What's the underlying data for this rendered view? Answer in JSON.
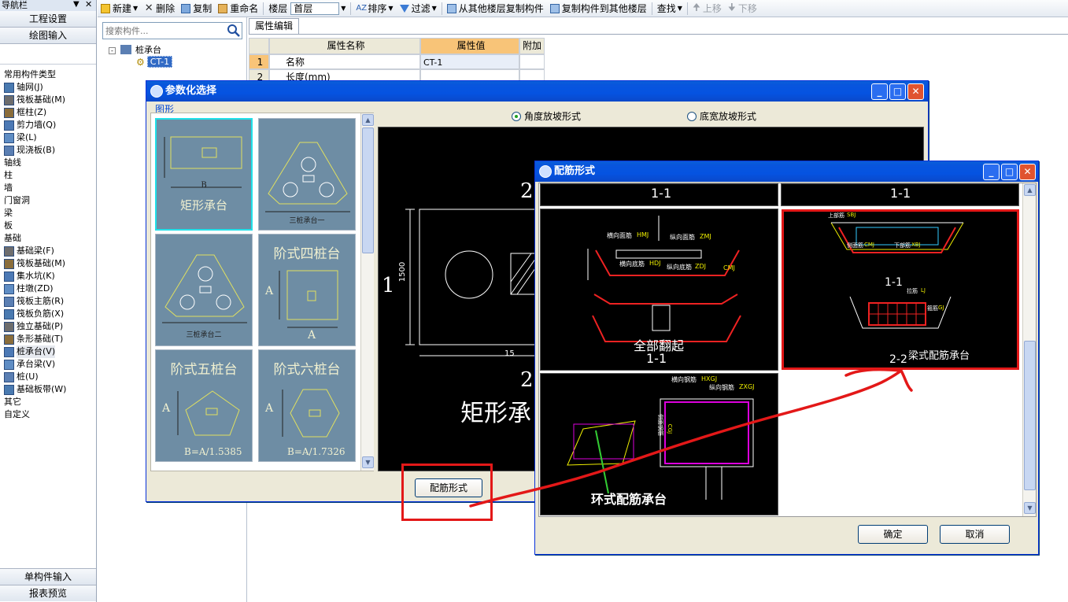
{
  "nav": {
    "title": "导航栏",
    "top_buttons": [
      "工程设置",
      "绘图输入"
    ],
    "tree": [
      {
        "label": "常用构件类型",
        "indent": 0,
        "icon": false
      },
      {
        "label": "轴网(J)",
        "indent": 1,
        "icon": true
      },
      {
        "label": "筏板基础(M)",
        "indent": 1,
        "icon": true
      },
      {
        "label": "框柱(Z)",
        "indent": 1,
        "icon": true
      },
      {
        "label": "剪力墙(Q)",
        "indent": 1,
        "icon": true
      },
      {
        "label": "梁(L)",
        "indent": 1,
        "icon": true
      },
      {
        "label": "现浇板(B)",
        "indent": 1,
        "icon": true
      },
      {
        "label": "轴线",
        "indent": 0,
        "icon": false
      },
      {
        "label": "柱",
        "indent": 0,
        "icon": false
      },
      {
        "label": "墙",
        "indent": 0,
        "icon": false
      },
      {
        "label": "门窗洞",
        "indent": 0,
        "icon": false
      },
      {
        "label": "梁",
        "indent": 0,
        "icon": false
      },
      {
        "label": "板",
        "indent": 0,
        "icon": false
      },
      {
        "label": "基础",
        "indent": 0,
        "icon": false
      },
      {
        "label": "基础梁(F)",
        "indent": 1,
        "icon": true
      },
      {
        "label": "筏板基础(M)",
        "indent": 1,
        "icon": true
      },
      {
        "label": "集水坑(K)",
        "indent": 1,
        "icon": true
      },
      {
        "label": "柱墩(ZD)",
        "indent": 1,
        "icon": true
      },
      {
        "label": "筏板主筋(R)",
        "indent": 1,
        "icon": true
      },
      {
        "label": "筏板负筋(X)",
        "indent": 1,
        "icon": true
      },
      {
        "label": "独立基础(P)",
        "indent": 1,
        "icon": true
      },
      {
        "label": "条形基础(T)",
        "indent": 1,
        "icon": true
      },
      {
        "label": "桩承台(V)",
        "indent": 1,
        "icon": true
      },
      {
        "label": "承台梁(V)",
        "indent": 1,
        "icon": true
      },
      {
        "label": "桩(U)",
        "indent": 1,
        "icon": true
      },
      {
        "label": "基础板带(W)",
        "indent": 1,
        "icon": true
      },
      {
        "label": "其它",
        "indent": 0,
        "icon": false
      },
      {
        "label": "自定义",
        "indent": 0,
        "icon": false
      }
    ],
    "bottom_buttons": [
      "单构件输入",
      "报表预览"
    ]
  },
  "toolbar": {
    "new": "新建",
    "delete": "删除",
    "copy": "复制",
    "rename": "重命名",
    "floor_label": "楼层",
    "floor_value": "首层",
    "sort": "排序",
    "filter": "过滤",
    "copy_from_floor": "从其他楼层复制构件",
    "copy_to_floor": "复制构件到其他楼层",
    "find": "查找",
    "move_up": "上移",
    "move_down": "下移"
  },
  "search": {
    "placeholder": "搜索构件..."
  },
  "component_tree": {
    "root": "桩承台",
    "child": "CT-1"
  },
  "property_editor": {
    "tab": "属性编辑",
    "headers": [
      "属性名称",
      "属性值",
      "附加"
    ],
    "rows": [
      {
        "index": "1",
        "name": "名称",
        "value": "CT-1"
      },
      {
        "index": "2",
        "name": "长度(mm)",
        "value": ""
      }
    ]
  },
  "param_dialog": {
    "title": "参数化选择",
    "group_label": "图形",
    "radio_angle": "角度放坡形式",
    "radio_width": "底宽放坡形式",
    "button": "配筋形式",
    "thumbs": [
      {
        "title": "矩形承台",
        "dim": "B"
      },
      {
        "title": "三桩承台一",
        "dim": ""
      },
      {
        "title": "三桩承台二",
        "dim": ""
      },
      {
        "title": "阶式四桩台",
        "dim": "A"
      },
      {
        "title": "阶式五桩台",
        "dim": "B=A/1.5385"
      },
      {
        "title": "阶式六桩台",
        "dim": "B=A/1.7326"
      }
    ],
    "preview": {
      "label_1": "1",
      "label_2_top": "2",
      "label_2_bottom": "2",
      "dim_1500": "1500",
      "dim_bottom": "15",
      "caption": "矩形承"
    }
  },
  "rebar_dialog": {
    "title": "配筋形式",
    "ok": "确定",
    "cancel": "取消",
    "cells": [
      {
        "section_top": "1-1",
        "caption": "全部翻起",
        "section_bottom": "1-1",
        "labels": [
          "横向面筋",
          "HMJ",
          "纵向面筋",
          "ZMJ",
          "横向底筋",
          "HDJ",
          "纵向底筋",
          "ZDJ",
          "CMJ"
        ]
      },
      {
        "section_top": "1-1",
        "caption": "梁式配筋承台",
        "section_mid": "1-1",
        "section_bottom": "2-2",
        "labels": [
          "上部筋",
          "SBJ",
          "侧面筋",
          "CMJ",
          "下部筋",
          "XBJ",
          "拉筋",
          "LJ",
          "箍筋",
          "GJ"
        ]
      },
      {
        "caption": "环式配筋承台",
        "labels": [
          "横向钢筋",
          "HXGJ",
          "纵向钢筋",
          "ZXGJ",
          "侧面钢筋",
          "CGJ"
        ]
      }
    ]
  },
  "colors": {
    "highlight": "#e31818",
    "xp_blue": "#0a5fd8",
    "thumb_bg": "#6e8da4",
    "cad_bg": "#000000"
  }
}
